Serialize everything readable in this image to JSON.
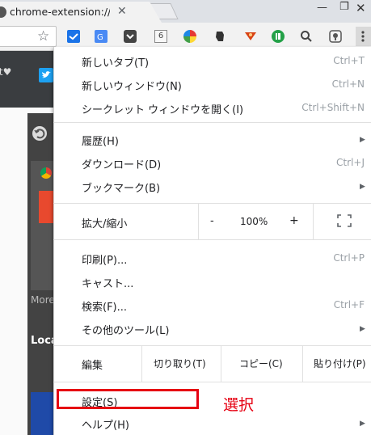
{
  "tab": {
    "title": "chrome-extension://nli",
    "close": "✕"
  },
  "window_controls": {
    "minimize": "—",
    "maximize": "❐",
    "close": "✕"
  },
  "toolbar": {
    "bookmark_star": "☆",
    "ext_counter": "6"
  },
  "background_page": {
    "fav_text": "rt♥",
    "more_label": "More",
    "local_label": "Loca"
  },
  "menu": {
    "new_tab": {
      "label": "新しいタブ(T)",
      "shortcut": "Ctrl+T"
    },
    "new_window": {
      "label": "新しいウィンドウ(N)",
      "shortcut": "Ctrl+N"
    },
    "incognito": {
      "label": "シークレット ウィンドウを開く(I)",
      "shortcut": "Ctrl+Shift+N"
    },
    "history": {
      "label": "履歴(H)"
    },
    "downloads": {
      "label": "ダウンロード(D)",
      "shortcut": "Ctrl+J"
    },
    "bookmarks": {
      "label": "ブックマーク(B)"
    },
    "zoom": {
      "label": "拡大/縮小",
      "minus": "-",
      "value": "100%",
      "plus": "+"
    },
    "print": {
      "label": "印刷(P)...",
      "shortcut": "Ctrl+P"
    },
    "cast": {
      "label": "キャスト..."
    },
    "find": {
      "label": "検索(F)...",
      "shortcut": "Ctrl+F"
    },
    "more_tools": {
      "label": "その他のツール(L)"
    },
    "edit": {
      "label": "編集",
      "cut": "切り取り(T)",
      "copy": "コピー(C)",
      "paste": "貼り付け(P)"
    },
    "settings": {
      "label": "設定(S)"
    },
    "help": {
      "label": "ヘルプ(H)"
    }
  },
  "annotation": {
    "text": "選択",
    "color": "#e60012"
  }
}
